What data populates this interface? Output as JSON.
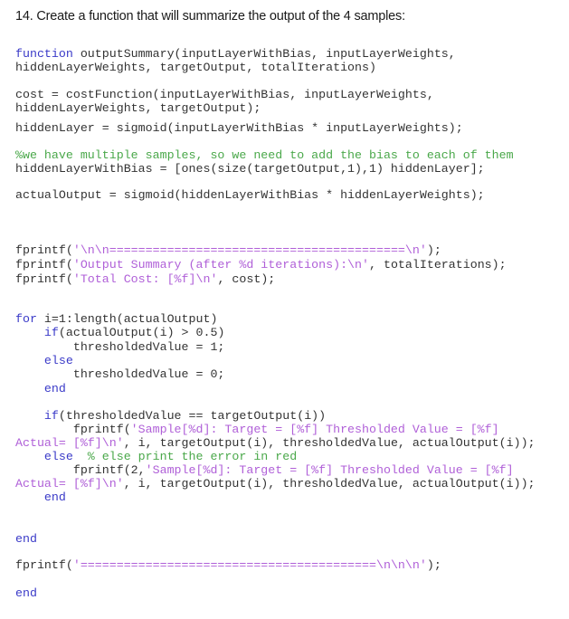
{
  "heading": "14. Create a function that will summarize the output of the 4 samples:",
  "colors": {
    "keyword": "#3a3ac8",
    "string": "#b060d8",
    "comment": "#4aa84a",
    "text": "#333333"
  },
  "code": {
    "l1": {
      "kw": "function",
      "rest": " outputSummary(inputLayerWithBias, inputLayerWeights,"
    },
    "l2": "hiddenLayerWeights, targetOutput, totalIterations)",
    "l3": "cost = costFunction(inputLayerWithBias, inputLayerWeights,",
    "l4": "hiddenLayerWeights, targetOutput);",
    "l5": "hiddenLayer = sigmoid(inputLayerWithBias * inputLayerWeights);",
    "l6": "%we have multiple samples, so we need to add the bias to each of them",
    "l7": "hiddenLayerWithBias = [ones(size(targetOutput,1),1) hiddenLayer];",
    "l8": "actualOutput = sigmoid(hiddenLayerWithBias * hiddenLayerWeights);",
    "l9": {
      "pre": "fprintf(",
      "str": "'\\n\\n=========================================\\n'",
      "post": ");"
    },
    "l10": {
      "pre": "fprintf(",
      "str": "'Output Summary (after %d iterations):\\n'",
      "post": ", totalIterations);"
    },
    "l11": {
      "pre": "fprintf(",
      "str": "'Total Cost: [%f]\\n'",
      "post": ", cost);"
    },
    "l12": {
      "kw": "for",
      "rest": " i=1:length(actualOutput)"
    },
    "l13": {
      "indent": "    ",
      "kw": "if",
      "rest": "(actualOutput(i) > 0.5)"
    },
    "l14": "        thresholdedValue = 1;",
    "l15": {
      "indent": "    ",
      "kw": "else"
    },
    "l16": "        thresholdedValue = 0;",
    "l17": {
      "indent": "    ",
      "kw": "end"
    },
    "l18": {
      "indent": "    ",
      "kw": "if",
      "rest": "(thresholdedValue == targetOutput(i))"
    },
    "l19": {
      "pre": "        fprintf(",
      "str": "'Sample[%d]: Target = [%f] Thresholded Value = [%f]"
    },
    "l20": {
      "str": "Actual= [%f]\\n'",
      "post": ", i, targetOutput(i), thresholdedValue, actualOutput(i));"
    },
    "l21": {
      "indent": "    ",
      "kw": "else",
      "cmt": "  % else print the error in red"
    },
    "l22": {
      "pre": "        fprintf(2,",
      "str": "'Sample[%d]: Target = [%f] Thresholded Value = [%f]"
    },
    "l23": {
      "str": "Actual= [%f]\\n'",
      "post": ", i, targetOutput(i), thresholdedValue, actualOutput(i));"
    },
    "l24": {
      "indent": "    ",
      "kw": "end"
    },
    "l25": {
      "kw": "end"
    },
    "l26": {
      "pre": "fprintf(",
      "str": "'=========================================\\n\\n\\n'",
      "post": ");"
    },
    "l27": {
      "kw": "end"
    }
  }
}
